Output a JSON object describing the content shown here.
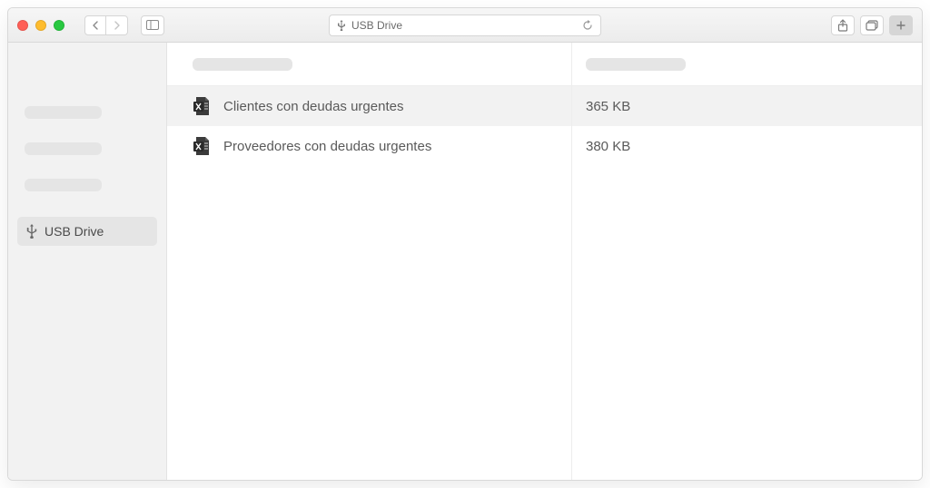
{
  "titlebar": {
    "location_label": "USB Drive"
  },
  "sidebar": {
    "active_item_label": "USB Drive"
  },
  "files": [
    {
      "name": "Clientes con deudas urgentes",
      "size": "365 KB",
      "selected": true
    },
    {
      "name": "Proveedores con deudas urgentes",
      "size": "380 KB",
      "selected": false
    }
  ]
}
